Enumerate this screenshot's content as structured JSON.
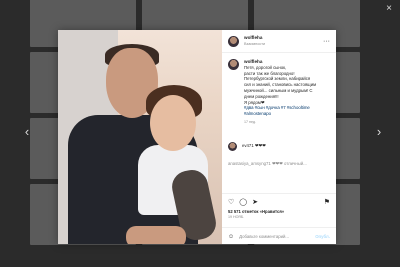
{
  "close_icon": "×",
  "nav": {
    "prev": "‹",
    "next": "›"
  },
  "post": {
    "username": "wolfleha",
    "subtitle": "Взаимности",
    "more_icon": "···",
    "caption_lines": [
      "Петя, дорогой сынок,",
      "расти так же благородно!",
      "Петербургской земли, набирайся",
      "сил и знаний, становись настоящим",
      "мужчиной... сильным и мудрым! С",
      "днем рождения!!!",
      "Я рядом❤"
    ],
    "hashtags": "#два #сын #дочка #7 #schooltime #almostenapo",
    "time": "17 нед.",
    "comment1": "ev471 ❤❤❤",
    "comment2": "anastasiya_amsyng71 ❤❤❤ отличный...",
    "likes": "52 571 отметок «Нравится»",
    "ago": "19 НОЯБ.",
    "add_comment_placeholder": "Добавьте комментарий...",
    "publish": "Опубл.",
    "icons": {
      "like": "♡",
      "comment": "◯",
      "share": "➤",
      "save": "⚑",
      "emoji": "☺"
    }
  }
}
